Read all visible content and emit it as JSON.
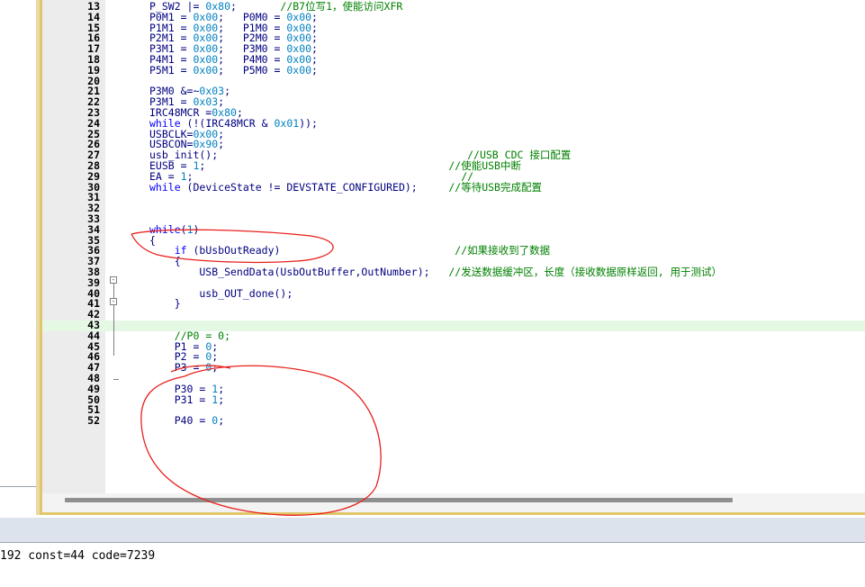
{
  "editor": {
    "lines": [
      {
        "n": "13",
        "tokens": [
          {
            "t": "P_SW2 |= "
          },
          {
            "t": "0x80",
            "c": "num"
          },
          {
            "t": ";       "
          },
          {
            "t": "//B7位写1，使能访问XFR",
            "c": "cm"
          }
        ]
      },
      {
        "n": "14",
        "tokens": [
          {
            "t": "P0M1 = "
          },
          {
            "t": "0x00",
            "c": "num"
          },
          {
            "t": ";   P0M0 = "
          },
          {
            "t": "0x00",
            "c": "num"
          },
          {
            "t": ";"
          }
        ]
      },
      {
        "n": "15",
        "tokens": [
          {
            "t": "P1M1 = "
          },
          {
            "t": "0x00",
            "c": "num"
          },
          {
            "t": ";   P1M0 = "
          },
          {
            "t": "0x00",
            "c": "num"
          },
          {
            "t": ";"
          }
        ]
      },
      {
        "n": "16",
        "tokens": [
          {
            "t": "P2M1 = "
          },
          {
            "t": "0x00",
            "c": "num"
          },
          {
            "t": ";   P2M0 = "
          },
          {
            "t": "0x00",
            "c": "num"
          },
          {
            "t": ";"
          }
        ]
      },
      {
        "n": "17",
        "tokens": [
          {
            "t": "P3M1 = "
          },
          {
            "t": "0x00",
            "c": "num"
          },
          {
            "t": ";   P3M0 = "
          },
          {
            "t": "0x00",
            "c": "num"
          },
          {
            "t": ";"
          }
        ]
      },
      {
        "n": "18",
        "tokens": [
          {
            "t": "P4M1 = "
          },
          {
            "t": "0x00",
            "c": "num"
          },
          {
            "t": ";   P4M0 = "
          },
          {
            "t": "0x00",
            "c": "num"
          },
          {
            "t": ";"
          }
        ]
      },
      {
        "n": "19",
        "tokens": [
          {
            "t": "P5M1 = "
          },
          {
            "t": "0x00",
            "c": "num"
          },
          {
            "t": ";   P5M0 = "
          },
          {
            "t": "0x00",
            "c": "num"
          },
          {
            "t": ";"
          }
        ]
      },
      {
        "n": "20",
        "tokens": []
      },
      {
        "n": "21",
        "tokens": [
          {
            "t": "P3M0 &=~"
          },
          {
            "t": "0x03",
            "c": "num"
          },
          {
            "t": ";"
          }
        ]
      },
      {
        "n": "22",
        "tokens": [
          {
            "t": "P3M1 = "
          },
          {
            "t": "0x03",
            "c": "num"
          },
          {
            "t": ";"
          }
        ]
      },
      {
        "n": "23",
        "tokens": [
          {
            "t": "IRC48MCR ="
          },
          {
            "t": "0x80",
            "c": "num"
          },
          {
            "t": ";"
          }
        ]
      },
      {
        "n": "24",
        "tokens": [
          {
            "t": "while",
            "c": "kw"
          },
          {
            "t": " (!(IRC48MCR & "
          },
          {
            "t": "0x01",
            "c": "num"
          },
          {
            "t": "));"
          }
        ]
      },
      {
        "n": "25",
        "tokens": [
          {
            "t": "USBCLK="
          },
          {
            "t": "0x00",
            "c": "num"
          },
          {
            "t": ";"
          }
        ]
      },
      {
        "n": "26",
        "tokens": [
          {
            "t": "USBCON="
          },
          {
            "t": "0x90",
            "c": "num"
          },
          {
            "t": ";"
          }
        ]
      },
      {
        "n": "27",
        "tokens": [
          {
            "t": "usb_init();                                        "
          },
          {
            "t": "//USB CDC 接口配置",
            "c": "cm"
          }
        ]
      },
      {
        "n": "28",
        "tokens": [
          {
            "t": "EUSB = "
          },
          {
            "t": "1",
            "c": "num"
          },
          {
            "t": ";                                       "
          },
          {
            "t": "//使能USB中断",
            "c": "cm"
          }
        ]
      },
      {
        "n": "29",
        "tokens": [
          {
            "t": "EA = "
          },
          {
            "t": "1",
            "c": "num"
          },
          {
            "t": ";                                           "
          },
          {
            "t": "//",
            "c": "cm"
          }
        ]
      },
      {
        "n": "30",
        "tokens": [
          {
            "t": "while",
            "c": "kw"
          },
          {
            "t": " (DeviceState != DEVSTATE_CONFIGURED);     "
          },
          {
            "t": "//等待USB完成配置",
            "c": "cm"
          }
        ]
      },
      {
        "n": "31",
        "tokens": []
      },
      {
        "n": "32",
        "tokens": []
      },
      {
        "n": "33",
        "tokens": []
      },
      {
        "n": "34",
        "tokens": [
          {
            "t": "while",
            "c": "kw"
          },
          {
            "t": "("
          },
          {
            "t": "1",
            "c": "num"
          },
          {
            "t": ")"
          }
        ]
      },
      {
        "n": "35",
        "tokens": [
          {
            "t": "{"
          }
        ]
      },
      {
        "n": "36",
        "tokens": [
          {
            "t": "    "
          },
          {
            "t": "if",
            "c": "kw"
          },
          {
            "t": " (bUsbOutReady)                            "
          },
          {
            "t": "//如果接收到了数据",
            "c": "cm"
          }
        ]
      },
      {
        "n": "37",
        "tokens": [
          {
            "t": "    {"
          }
        ]
      },
      {
        "n": "38",
        "tokens": [
          {
            "t": "        USB_SendData(UsbOutBuffer,OutNumber);   "
          },
          {
            "t": "//发送数据缓冲区，长度（接收数据原样返回, 用于测试）",
            "c": "cm"
          }
        ]
      },
      {
        "n": "39",
        "tokens": []
      },
      {
        "n": "40",
        "tokens": [
          {
            "t": "        usb_OUT_done();"
          }
        ]
      },
      {
        "n": "41",
        "tokens": [
          {
            "t": "    }"
          }
        ]
      },
      {
        "n": "42",
        "tokens": []
      },
      {
        "n": "43",
        "tokens": []
      },
      {
        "n": "44",
        "tokens": [
          {
            "t": "    "
          },
          {
            "t": "//P0 = 0;",
            "c": "cm"
          }
        ]
      },
      {
        "n": "45",
        "tokens": [
          {
            "t": "    P1 = "
          },
          {
            "t": "0",
            "c": "num"
          },
          {
            "t": ";"
          }
        ]
      },
      {
        "n": "46",
        "tokens": [
          {
            "t": "    P2 = "
          },
          {
            "t": "0",
            "c": "num"
          },
          {
            "t": ";"
          }
        ]
      },
      {
        "n": "47",
        "tokens": [
          {
            "t": "    P3 = "
          },
          {
            "t": "0",
            "c": "num"
          },
          {
            "t": ";"
          }
        ]
      },
      {
        "n": "48",
        "tokens": []
      },
      {
        "n": "49",
        "tokens": [
          {
            "t": "    P30 = "
          },
          {
            "t": "1",
            "c": "num"
          },
          {
            "t": ";"
          }
        ]
      },
      {
        "n": "50",
        "tokens": [
          {
            "t": "    P31 = "
          },
          {
            "t": "1",
            "c": "num"
          },
          {
            "t": ";"
          }
        ]
      },
      {
        "n": "51",
        "tokens": []
      },
      {
        "n": "52",
        "tokens": [
          {
            "t": "    P40 = "
          },
          {
            "t": "0",
            "c": "num"
          },
          {
            "t": ";"
          }
        ]
      }
    ],
    "current_line": "43",
    "fold_markers": [
      "35",
      "37"
    ]
  },
  "output": {
    "text": "192 const=44 code=7239"
  },
  "annotation_color": "#e8201c"
}
